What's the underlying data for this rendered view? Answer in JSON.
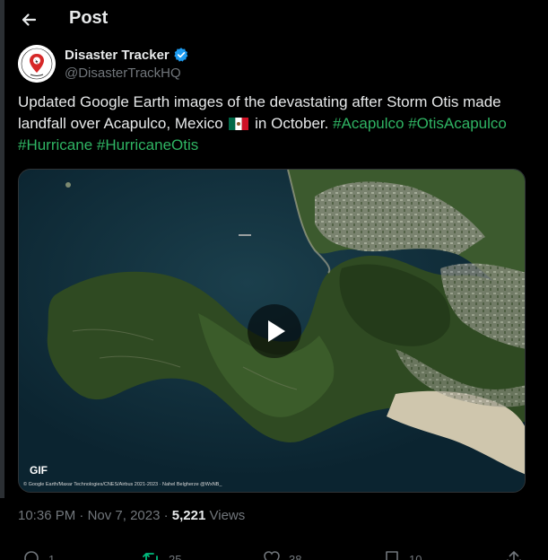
{
  "header": {
    "title": "Post"
  },
  "author": {
    "display_name": "Disaster Tracker",
    "handle": "@DisasterTrackHQ",
    "avatar_text": "DISASTER TRACKER"
  },
  "tweet": {
    "text_part1": "Updated Google Earth images of the devastating after Storm Otis made landfall over Acapulco, Mexico",
    "flag": "mexico-flag-emoji",
    "text_part2": " in October. ",
    "hashtags": [
      "#Acapulco",
      "#OtisAcapulco",
      "#Hurricane",
      "#HurricaneOtis"
    ]
  },
  "media": {
    "badge": "GIF",
    "credit": "© Google Earth/Maxar Technologies/CNES/Airbus 2021-2023 · Nahel Belgherze @WxNB_"
  },
  "meta": {
    "time": "10:36 PM",
    "date": "Nov 7, 2023",
    "views_count": "5,221",
    "views_label": " Views"
  },
  "actions": {
    "reply_count": "1",
    "repost_count": "25",
    "like_count": "38",
    "bookmark_count": "10"
  },
  "colors": {
    "background": "#000000",
    "text": "#e7e9ea",
    "muted": "#71767b",
    "hashtag": "#2fb463",
    "verified": "#1d9bf0"
  }
}
